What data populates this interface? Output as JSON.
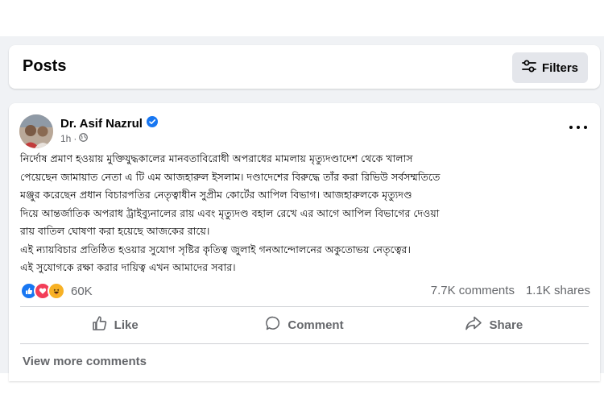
{
  "header": {
    "title": "Posts",
    "filters_label": "Filters",
    "filters_icon": "sliders-icon"
  },
  "post": {
    "author": "Dr. Asif Nazrul",
    "verified_icon": "verified-badge-icon",
    "time": "1h",
    "audience_icon": "globe-icon",
    "lines": [
      "নির্দোষ প্রমাণ হওয়ায় মুক্তিযুদ্ধকালের মানবতাবিরোধী অপরাধের মামলায় মৃত্যুদণ্ডাদেশ থেকে খালাস",
      "পেয়েছেন জামায়াত নেতা এ টি এম আজহারুল ইসলাম। দণ্ডাদেশের বিরুদ্ধে তাঁর করা রিভিউ সর্বসম্মতিতে",
      "মঞ্জুর করেছেন প্রধান বিচারপতির নেতৃত্বাধীন সুপ্রীম কোর্টের আপিল বিভাগ। আজহারুলকে মৃত্যুদণ্ড",
      "দিয়ে আন্তর্জাতিক অপরাধ ট্রাইব্যুনালের রায় এবং মৃত্যুদণ্ড বহাল রেখে এর আগে আপিল বিভাগের দেওয়া",
      "রায় বাতিল ঘোষণা করা হয়েছে আজকের রায়ে।",
      "এই ন্যায়বিচার প্রতিষ্ঠিত হওয়ার সুযোগ সৃষ্টির কৃতিত্ব জুলাই গনআন্দোলনের অকুতোভয় নেতৃত্বের।",
      "এই সুযোগকে রক্ষা করার দায়িত্ব এখন আমাদের সবার।"
    ],
    "reactions": {
      "icons": [
        "like-reaction-icon",
        "love-reaction-icon",
        "haha-reaction-icon"
      ],
      "count": "60K"
    },
    "comments": "7.7K comments",
    "shares": "1.1K shares",
    "actions": {
      "like": "Like",
      "comment": "Comment",
      "share": "Share"
    },
    "view_more": "View more comments"
  },
  "colors": {
    "like_blue": "#1877f2",
    "love_red": "#f33e58",
    "haha_yellow": "#f7b125",
    "secondary_text": "#65676b",
    "page_bg": "#f0f2f5"
  }
}
